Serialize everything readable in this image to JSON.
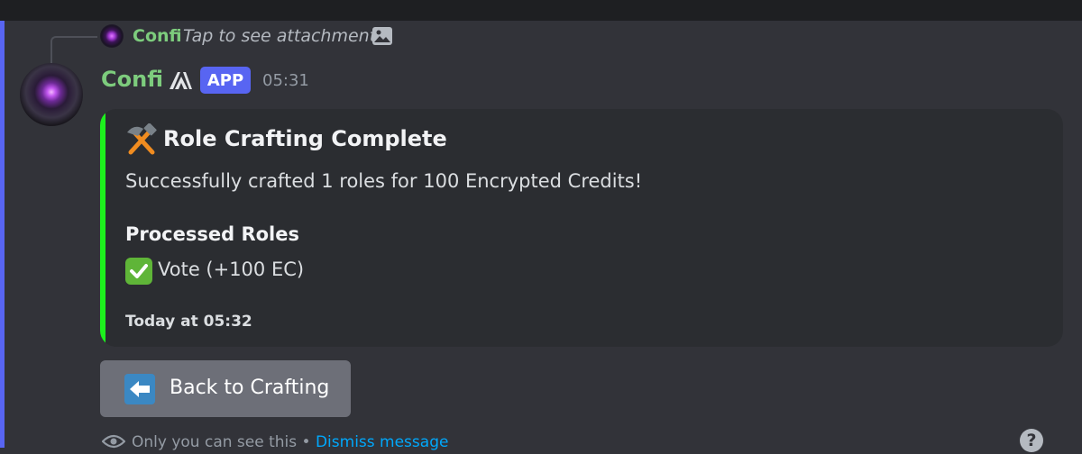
{
  "reply": {
    "author": "Confi",
    "text": "Tap to see attachment",
    "icon": "image-icon"
  },
  "message": {
    "author": "Confi",
    "author_color": "#7dcc7d",
    "badge": "APP",
    "timestamp": "05:31"
  },
  "embed": {
    "accent_color": "#1df01d",
    "icon": "hammer-and-pick-icon",
    "title": "Role Crafting Complete",
    "description": "Successfully crafted 1 roles for 100 Encrypted Credits!",
    "field_name": "Processed Roles",
    "field_value": "Vote (+100 EC)",
    "field_icon": "check-mark-button-icon",
    "footer": "Today at 05:32"
  },
  "button": {
    "icon": "left-arrow-icon",
    "label": "Back to Crafting"
  },
  "ephemeral": {
    "note": "Only you can see this",
    "separator": " • ",
    "dismiss": "Dismiss message"
  },
  "help": {
    "label": "?"
  }
}
